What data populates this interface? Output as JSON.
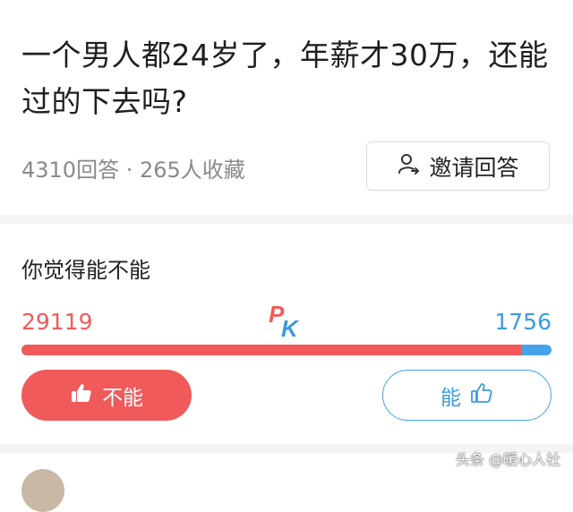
{
  "question": {
    "title": "一个男人都24岁了，年薪才30万，还能过的下去吗?"
  },
  "meta": {
    "stats": "4310回答 · 265人收藏"
  },
  "invite": {
    "label": "邀请回答",
    "icon": "invite-user-icon"
  },
  "poll": {
    "title": "你觉得能不能",
    "left_count": "29119",
    "right_count": "1756",
    "pk_label_p": "P",
    "pk_label_k": "K",
    "left_share": 0.9431,
    "left_color": "#f25a5a",
    "right_color": "#45a3ea",
    "no_button_label": "不能",
    "yes_button_label": "能"
  },
  "watermark": {
    "text": "头条 @暖心人社"
  }
}
